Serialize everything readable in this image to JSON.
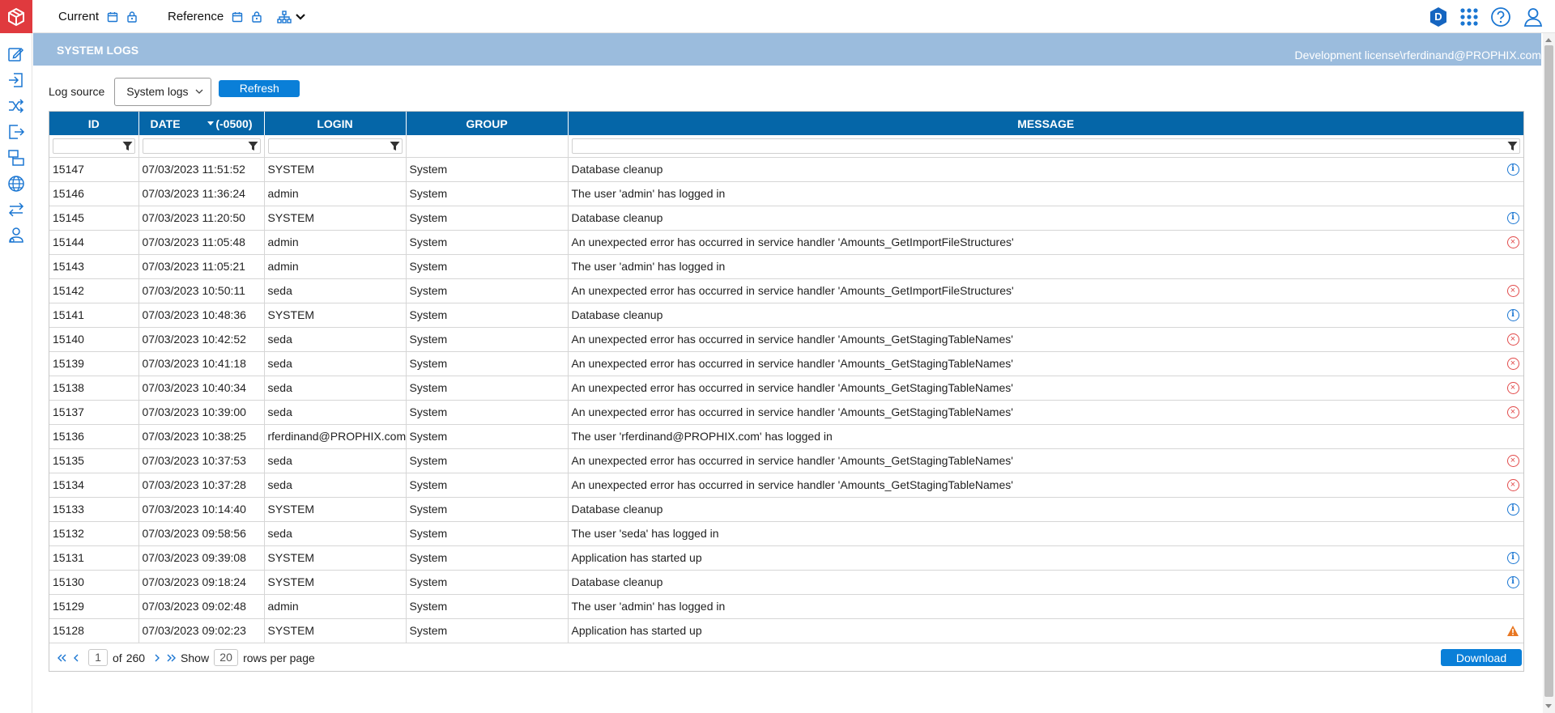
{
  "topbar": {
    "current_label": "Current",
    "reference_label": "Reference",
    "user_initial": "D"
  },
  "page": {
    "title": "SYSTEM LOGS",
    "license": "Development license\\rferdinand@PROPHIX.com"
  },
  "controls": {
    "log_source_label": "Log source",
    "log_source_value": "System logs",
    "refresh_label": "Refresh"
  },
  "table": {
    "headers": {
      "id": "ID",
      "date": "DATE",
      "date_tz": "(-0500)",
      "login": "LOGIN",
      "group": "GROUP",
      "message": "MESSAGE"
    },
    "rows": [
      {
        "id": "15147",
        "date": "07/03/2023 11:51:52",
        "login": "SYSTEM",
        "group": "System",
        "message": "Database cleanup",
        "icon": "info"
      },
      {
        "id": "15146",
        "date": "07/03/2023 11:36:24",
        "login": "admin",
        "group": "System",
        "message": "The user 'admin' has logged in",
        "icon": ""
      },
      {
        "id": "15145",
        "date": "07/03/2023 11:20:50",
        "login": "SYSTEM",
        "group": "System",
        "message": "Database cleanup",
        "icon": "info"
      },
      {
        "id": "15144",
        "date": "07/03/2023 11:05:48",
        "login": "admin",
        "group": "System",
        "message": "An unexpected error has occurred in service handler 'Amounts_GetImportFileStructures'",
        "icon": "error"
      },
      {
        "id": "15143",
        "date": "07/03/2023 11:05:21",
        "login": "admin",
        "group": "System",
        "message": "The user 'admin' has logged in",
        "icon": ""
      },
      {
        "id": "15142",
        "date": "07/03/2023 10:50:11",
        "login": "seda",
        "group": "System",
        "message": "An unexpected error has occurred in service handler 'Amounts_GetImportFileStructures'",
        "icon": "error"
      },
      {
        "id": "15141",
        "date": "07/03/2023 10:48:36",
        "login": "SYSTEM",
        "group": "System",
        "message": "Database cleanup",
        "icon": "info"
      },
      {
        "id": "15140",
        "date": "07/03/2023 10:42:52",
        "login": "seda",
        "group": "System",
        "message": "An unexpected error has occurred in service handler 'Amounts_GetStagingTableNames'",
        "icon": "error"
      },
      {
        "id": "15139",
        "date": "07/03/2023 10:41:18",
        "login": "seda",
        "group": "System",
        "message": "An unexpected error has occurred in service handler 'Amounts_GetStagingTableNames'",
        "icon": "error"
      },
      {
        "id": "15138",
        "date": "07/03/2023 10:40:34",
        "login": "seda",
        "group": "System",
        "message": "An unexpected error has occurred in service handler 'Amounts_GetStagingTableNames'",
        "icon": "error"
      },
      {
        "id": "15137",
        "date": "07/03/2023 10:39:00",
        "login": "seda",
        "group": "System",
        "message": "An unexpected error has occurred in service handler 'Amounts_GetStagingTableNames'",
        "icon": "error"
      },
      {
        "id": "15136",
        "date": "07/03/2023 10:38:25",
        "login": "rferdinand@PROPHIX.com",
        "group": "System",
        "message": "The user 'rferdinand@PROPHIX.com' has logged in",
        "icon": ""
      },
      {
        "id": "15135",
        "date": "07/03/2023 10:37:53",
        "login": "seda",
        "group": "System",
        "message": "An unexpected error has occurred in service handler 'Amounts_GetStagingTableNames'",
        "icon": "error"
      },
      {
        "id": "15134",
        "date": "07/03/2023 10:37:28",
        "login": "seda",
        "group": "System",
        "message": "An unexpected error has occurred in service handler 'Amounts_GetStagingTableNames'",
        "icon": "error"
      },
      {
        "id": "15133",
        "date": "07/03/2023 10:14:40",
        "login": "SYSTEM",
        "group": "System",
        "message": "Database cleanup",
        "icon": "info"
      },
      {
        "id": "15132",
        "date": "07/03/2023 09:58:56",
        "login": "seda",
        "group": "System",
        "message": "The user 'seda' has logged in",
        "icon": ""
      },
      {
        "id": "15131",
        "date": "07/03/2023 09:39:08",
        "login": "SYSTEM",
        "group": "System",
        "message": "Application has started up",
        "icon": "info"
      },
      {
        "id": "15130",
        "date": "07/03/2023 09:18:24",
        "login": "SYSTEM",
        "group": "System",
        "message": "Database cleanup",
        "icon": "info"
      },
      {
        "id": "15129",
        "date": "07/03/2023 09:02:48",
        "login": "admin",
        "group": "System",
        "message": "The user 'admin' has logged in",
        "icon": ""
      },
      {
        "id": "15128",
        "date": "07/03/2023 09:02:23",
        "login": "SYSTEM",
        "group": "System",
        "message": "Application has started up",
        "icon": "warning"
      }
    ]
  },
  "pager": {
    "page": "1",
    "of_label": "of",
    "total_pages": "260",
    "show_label": "Show",
    "rows_per_page": "20",
    "rows_per_page_label": "rows per page",
    "download_label": "Download"
  },
  "colors": {
    "brand": "#e03a3e",
    "header_band": "#9bbcdd",
    "grid_header": "#0566a8",
    "button": "#0a7fd8",
    "info": "#1a76d2",
    "error": "#e24b4b",
    "warning": "#e87722"
  }
}
